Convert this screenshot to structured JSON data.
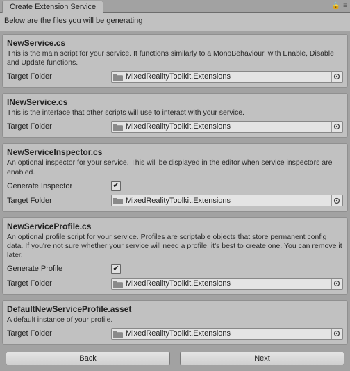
{
  "header": {
    "tab_title": "Create Extension Service"
  },
  "intro": "Below are the files you will be generating",
  "labels": {
    "target_folder": "Target Folder",
    "generate_inspector": "Generate Inspector",
    "generate_profile": "Generate Profile"
  },
  "buttons": {
    "back": "Back",
    "next": "Next"
  },
  "sections": [
    {
      "title": "NewService.cs",
      "desc": "This is the main script for your service. It functions similarly to a MonoBehaviour, with Enable, Disable and Update functions.",
      "target_folder": "MixedRealityToolkit.Extensions"
    },
    {
      "title": "INewService.cs",
      "desc": "This is the interface that other scripts will use to interact with your service.",
      "target_folder": "MixedRealityToolkit.Extensions"
    },
    {
      "title": "NewServiceInspector.cs",
      "desc": "An optional inspector for your service. This will be displayed in the editor when service inspectors are enabled.",
      "generate_inspector": true,
      "target_folder": "MixedRealityToolkit.Extensions"
    },
    {
      "title": "NewServiceProfile.cs",
      "desc": "An optional profile script for your service. Profiles are scriptable objects that store permanent config data. If you're not sure whether your service will need a profile, it's best to create one. You can remove it later.",
      "generate_profile": true,
      "target_folder": "MixedRealityToolkit.Extensions"
    },
    {
      "title": "DefaultNewServiceProfile.asset",
      "desc": "A default instance of your profile.",
      "target_folder": "MixedRealityToolkit.Extensions"
    }
  ]
}
